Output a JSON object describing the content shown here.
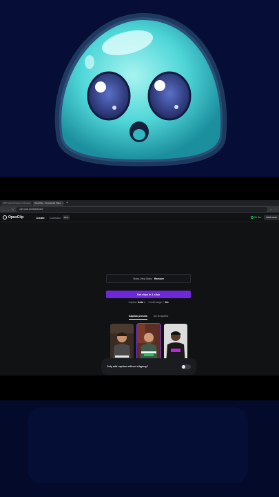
{
  "browser": {
    "tabs": [
      {
        "title": "ARY Superchargers Unbeaten",
        "active": false
      },
      {
        "title": "OpusClip - AI-powered Video",
        "active": true
      }
    ],
    "new_tab": "+",
    "url": "clip.opus.pro/dashboard"
  },
  "app": {
    "logo_text": "OpusClip",
    "nav": {
      "create": "Create",
      "calendar": "Calendar",
      "beta": "Beta"
    },
    "credits": "0h 0m",
    "add_button": "Add more"
  },
  "main": {
    "link_input": {
      "value": "Video-Vera.Video",
      "remove_label": "Remove"
    },
    "get_clips": "Get clips in 1 click",
    "options": {
      "caption_label": "Caption:",
      "caption_value": "Auto",
      "credit_label": "Credit usage:",
      "credit_value": "~ 0m"
    },
    "caption_tabs": [
      "Caption presets",
      "My templates"
    ],
    "presets": [
      {
        "label": "Deep Diver",
        "selected": false,
        "bg": "#3a2c24"
      },
      {
        "label": "Tokalland",
        "selected": true,
        "bg": "#5a2e23"
      },
      {
        "label": "Pod P",
        "selected": false,
        "bg": "#2a2a2e"
      }
    ],
    "only_caption": "Only add caption without clipping?"
  },
  "colors": {
    "accent": "#6d28d9",
    "credits": "#22c55e",
    "background": "#111214"
  }
}
